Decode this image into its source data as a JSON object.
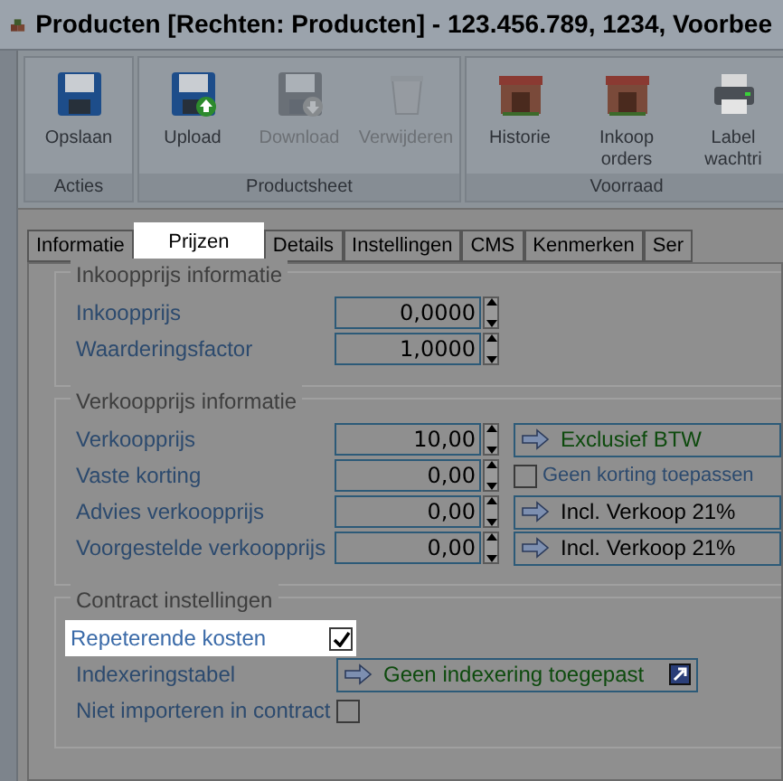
{
  "window": {
    "title": "Producten [Rechten: Producten] - 123.456.789, 1234, Voorbee"
  },
  "toolbar": {
    "groups": [
      {
        "label": "Acties",
        "buttons": [
          {
            "label": "Opslaan",
            "kind": "save",
            "disabled": false
          }
        ]
      },
      {
        "label": "Productsheet",
        "buttons": [
          {
            "label": "Upload",
            "kind": "upload",
            "disabled": false
          },
          {
            "label": "Download",
            "kind": "download",
            "disabled": true
          },
          {
            "label": "Verwijderen",
            "kind": "delete",
            "disabled": true
          }
        ]
      },
      {
        "label": "Voorraad",
        "buttons": [
          {
            "label": "Historie",
            "kind": "store",
            "disabled": false
          },
          {
            "label": "Inkoop orders",
            "kind": "store",
            "disabled": false
          },
          {
            "label": "Label wachtri",
            "kind": "print",
            "disabled": false
          }
        ]
      }
    ]
  },
  "tabs": [
    {
      "label": "Informatie",
      "selected": false
    },
    {
      "label": "Prijzen",
      "selected": true
    },
    {
      "label": "Details",
      "selected": false
    },
    {
      "label": "Instellingen",
      "selected": false
    },
    {
      "label": "CMS",
      "selected": false
    },
    {
      "label": "Kenmerken",
      "selected": false
    },
    {
      "label": "Ser",
      "selected": false
    }
  ],
  "sections": [
    {
      "title": "Inkoopprijs informatie",
      "rows": [
        {
          "label": "Inkoopprijs",
          "kind": "spinner",
          "value": "0,0000",
          "highlighted": false
        },
        {
          "label": "Waarderingsfactor",
          "kind": "spinner",
          "value": "1,0000",
          "highlighted": false
        }
      ]
    },
    {
      "title": "Verkoopprijs informatie",
      "rows": [
        {
          "label": "Verkoopprijs",
          "kind": "spinner",
          "value": "10,00",
          "highlighted": false,
          "side": {
            "kind": "lookup",
            "text": "Exclusief BTW",
            "color": "#0d4a0d"
          }
        },
        {
          "label": "Vaste korting",
          "kind": "spinner",
          "value": "0,00",
          "highlighted": false,
          "side": {
            "kind": "checkbox",
            "text": "Geen korting toepassen",
            "checked": false
          }
        },
        {
          "label": "Advies verkoopprijs",
          "kind": "spinner",
          "value": "0,00",
          "highlighted": false,
          "side": {
            "kind": "lookup",
            "text": "Incl. Verkoop 21%",
            "color": "#000000"
          }
        },
        {
          "label": "Voorgestelde verkoopprijs",
          "kind": "spinner",
          "value": "0,00",
          "highlighted": false,
          "side": {
            "kind": "lookup",
            "text": "Incl. Verkoop 21%",
            "color": "#000000"
          }
        }
      ]
    },
    {
      "title": "Contract instellingen",
      "rows": [
        {
          "label": "Repeterende kosten",
          "kind": "checkbox",
          "checked": true,
          "highlighted": true
        },
        {
          "label": "Indexeringstabel",
          "kind": "wide-lookup",
          "text": "Geen indexering toegepast",
          "color": "#0d4a0d",
          "highlighted": false
        },
        {
          "label": "Niet importeren in contract",
          "kind": "checkbox",
          "checked": false,
          "highlighted": false
        }
      ]
    }
  ]
}
